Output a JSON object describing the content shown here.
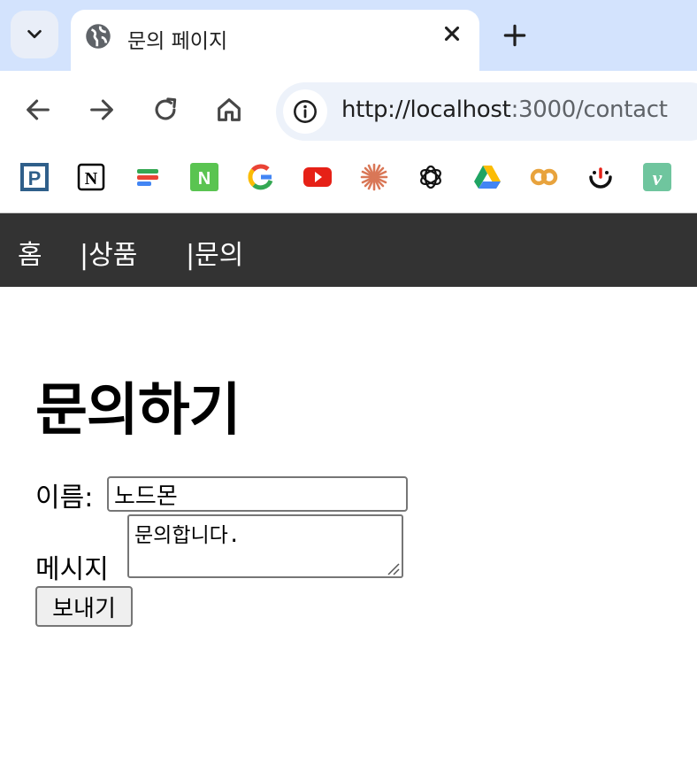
{
  "browser": {
    "tab": {
      "title": "문의 페이지",
      "favicon": "globe-icon"
    },
    "address": {
      "host": "http://localhost",
      "rest": ":3000/contact"
    },
    "bookmarks": [
      {
        "icon": "p-app-icon",
        "letter": "P",
        "color": "#2f5f8a"
      },
      {
        "icon": "notion-icon",
        "letter": "N",
        "color": "#000000"
      },
      {
        "icon": "stacked-bars-icon",
        "letter": "",
        "color": "#f29900"
      },
      {
        "icon": "naver-n-icon",
        "letter": "N",
        "color": "#5ac451"
      },
      {
        "icon": "google-icon",
        "letter": "G",
        "color": "#4285f4"
      },
      {
        "icon": "youtube-icon",
        "letter": "",
        "color": "#e62117"
      },
      {
        "icon": "claude-icon",
        "letter": "",
        "color": "#d97757"
      },
      {
        "icon": "openai-icon",
        "letter": "",
        "color": "#000000"
      },
      {
        "icon": "google-drive-icon",
        "letter": "",
        "color": "#1fa463"
      },
      {
        "icon": "colab-icon",
        "letter": "CO",
        "color": "#e8a33d"
      },
      {
        "icon": "smile-icon",
        "letter": "",
        "color": "#000000"
      },
      {
        "icon": "vimeo-icon",
        "letter": "v",
        "color": "#6fc59e"
      }
    ]
  },
  "nav": {
    "home": "홈",
    "products": "|상품",
    "contact": "|문의"
  },
  "page": {
    "title": "문의하기",
    "name_label": "이름:",
    "name_value": "노드몬",
    "message_label": "메시지",
    "message_value": "문의합니다.",
    "submit_label": "보내기"
  },
  "colors": {
    "nav_bg": "#333333",
    "tabstrip_bg": "#d3e3fd",
    "omnibox_bg": "#edf2fa"
  }
}
